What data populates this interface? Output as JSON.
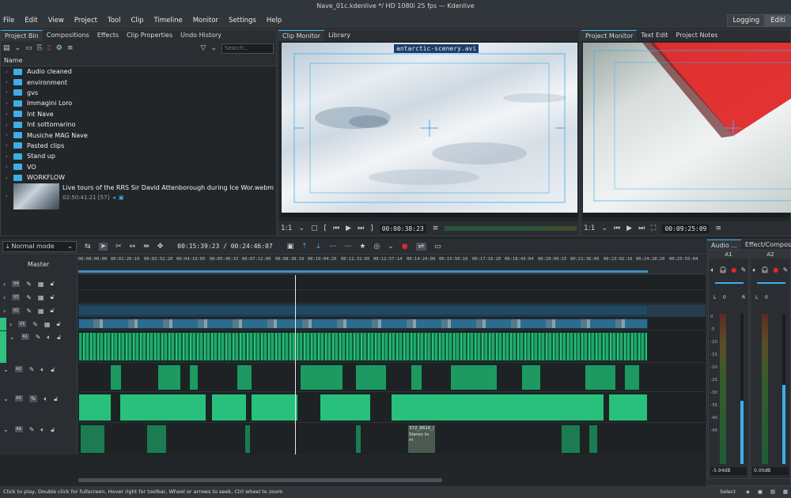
{
  "window": {
    "title": "Nave_01c.kdenlive */ HD 1080i 25 fps — Kdenlive"
  },
  "menu": [
    "File",
    "Edit",
    "View",
    "Project",
    "Tool",
    "Clip",
    "Timeline",
    "Monitor",
    "Settings",
    "Help"
  ],
  "layouts": [
    "Logging",
    "Editi"
  ],
  "bin_tabs": [
    "Project Bin",
    "Compositions",
    "Effects",
    "Clip Properties",
    "Undo History"
  ],
  "bin": {
    "search_placeholder": "Search...",
    "column": "Name",
    "folders": [
      "Audio cleaned",
      "environment",
      "gvs",
      "Immagini Loro",
      "Int Nave",
      "Int sottomarino",
      "Musiche MAG Nave",
      "Pasted clips",
      "Stand up",
      "VO",
      "WORKFLOW"
    ],
    "clip": {
      "name": "Live tours of the RRS Sir David Attenborough during Ice Wor.webm",
      "meta": "02:50:41:21 [57]"
    }
  },
  "clip_monitor": {
    "tabs": [
      "Clip Monitor",
      "Library"
    ],
    "overlay": "antarctic-scenery.avi",
    "zoom": "1:1",
    "timecode": "00:00:38:23"
  },
  "project_monitor": {
    "tabs": [
      "Project Monitor",
      "Text Edit",
      "Project Notes"
    ],
    "zoom": "1:1",
    "timecode": "00:09:25:09"
  },
  "timeline": {
    "edit_mode": "Normal mode",
    "position": "00:15:39:23 / 00:24:46:07",
    "master_label": "Master",
    "ruler": [
      "00:00:00:00",
      "00:01:20:10",
      "00:02:52:20",
      "00:04:19:05",
      "00:05:45:15",
      "00:07:12:00",
      "00:08:38:10",
      "00:10:04:20",
      "00:11:31:05",
      "00:12:57:14",
      "00:14:24:00",
      "00:15:50:10",
      "00:17:16:20",
      "00:18:43:04",
      "00:20:09:15",
      "00:21:36:00",
      "00:23:02:10",
      "00:24:28:20",
      "00:25:55:04"
    ],
    "tracks": [
      "V4",
      "V3",
      "V2",
      "V1",
      "A1",
      "A2",
      "A3",
      "A4"
    ],
    "clip_label": {
      "name": "372_8616_(",
      "desc": "Stereo to m"
    }
  },
  "mixer": {
    "tabs": [
      "Audio ...",
      "Effect/Compos"
    ],
    "strips": [
      {
        "name": "A1",
        "db": "-5.94dB"
      },
      {
        "name": "A2",
        "db": "0.00dB"
      }
    ],
    "scale": [
      "0",
      "-5",
      "-10",
      "-15",
      "-20",
      "-25",
      "-30",
      "-35",
      "-40",
      "-45"
    ],
    "lr": [
      "L",
      "0",
      "R",
      "0"
    ],
    "footer_button": "Select"
  },
  "status": {
    "hint": "Click to play, Double click for fullscreen, Hover right for toolbar, Wheel or arrows to seek, Ctrl wheel to zoom"
  },
  "colors": {
    "accent": "#3daee9",
    "audio_clip": "#2ec27e",
    "record": "#e0272a",
    "bg": "#232629"
  }
}
